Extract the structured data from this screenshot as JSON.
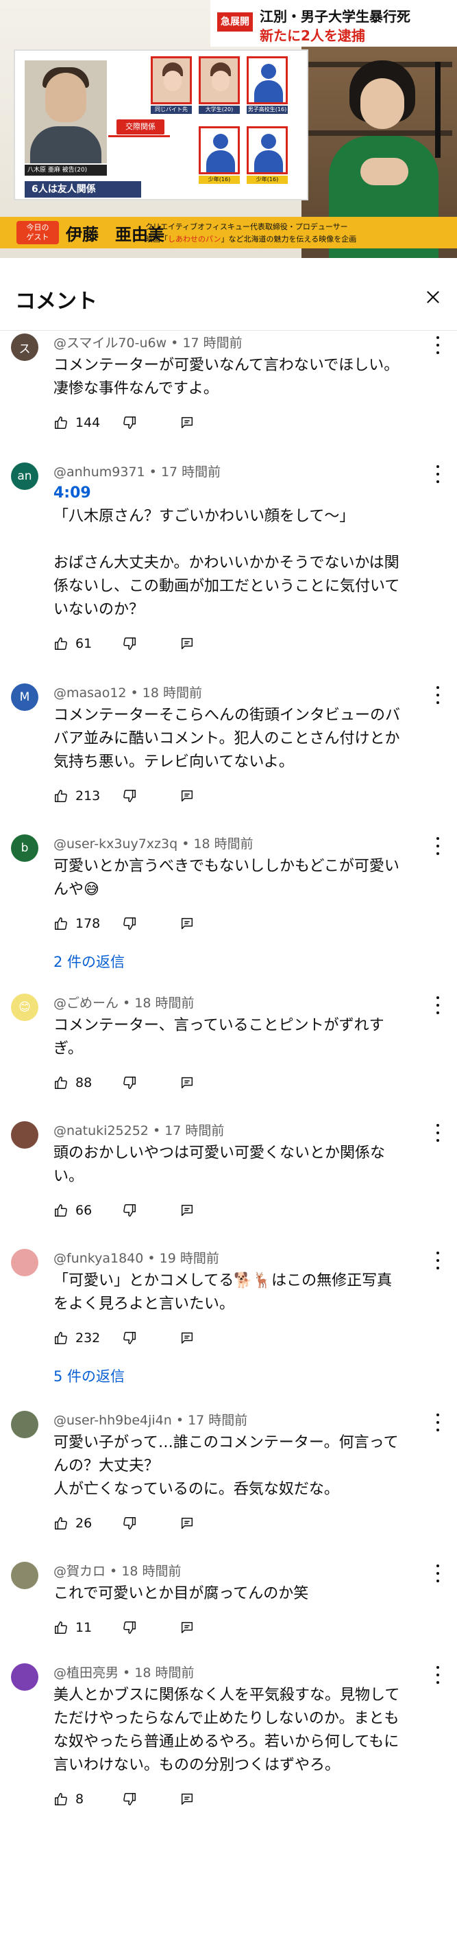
{
  "video": {
    "breaking": "急展開",
    "headline_line1": "江別・男子大学生暴行死",
    "headline_line2": "新たに2人を逮捕",
    "suspect_name_tag": "八木原 亜麻 被告(20)",
    "relation": "交際関係",
    "friends": "6人は友人関係",
    "today_badge": "今日の\nゲスト",
    "guest_name": "伊藤　亜由美",
    "guest_desc_line1": "クリエイティブオフィスキュー代表取締役・プロデューサー",
    "guest_desc_line2_pre": "映画「",
    "guest_desc_line2_hl": "しあわせのパン",
    "guest_desc_line2_post": "」など北海道の魅力を伝える映像を企画",
    "persons": [
      {
        "label": "同じバイト先",
        "kind": "photo"
      },
      {
        "label": "大学生(20)",
        "kind": "photo"
      },
      {
        "label": "男子高校生(16)",
        "kind": "blue"
      },
      {
        "label": "少年(16)",
        "kind": "blue"
      },
      {
        "label": "少年(16)",
        "kind": "blue"
      }
    ]
  },
  "sheet": {
    "title": "コメント"
  },
  "comments": [
    {
      "author": "@スマイル70-u6w",
      "time": "17 時間前",
      "avatar_letter": "ス",
      "avatar_color": "#5c4a3f",
      "timestamp": "",
      "lines": [
        "コメンテーターが可愛いなんて言わないでほしい。",
        "凄惨な事件なんですよ。"
      ],
      "likes": "144",
      "replies": ""
    },
    {
      "author": "@anhum9371",
      "time": "17 時間前",
      "avatar_letter": "an",
      "avatar_color": "#0f6b57",
      "timestamp": "4:09",
      "lines": [
        "「八木原さん？すごいかわいい顔をして〜」",
        "",
        "おばさん大丈夫か。かわいいかかそうでないかは関",
        "係ないし、この動画が加工だということに気付いて",
        "いないのか？"
      ],
      "likes": "61",
      "replies": ""
    },
    {
      "author": "@masao12",
      "time": "18 時間前",
      "avatar_letter": "M",
      "avatar_color": "#2d5fb0",
      "timestamp": "",
      "lines": [
        "コメンテーターそこらへんの街頭インタビューのバ",
        "バア並みに酷いコメント。犯人のことさん付けとか",
        "気持ち悪い。テレビ向いてないよ。"
      ],
      "likes": "213",
      "replies": ""
    },
    {
      "author": "@user-kx3uy7xz3q",
      "time": "18 時間前",
      "avatar_letter": "b",
      "avatar_color": "#1f6e3a",
      "timestamp": "",
      "lines": [
        "可愛いとか言うべきでもないししかもどこが可愛い",
        "んや😅"
      ],
      "likes": "178",
      "replies": "2 件の返信"
    },
    {
      "author": "@ごめーん",
      "time": "18 時間前",
      "avatar_letter": "😊",
      "avatar_color": "#f3e27a",
      "timestamp": "",
      "lines": [
        "コメンテーター、言っていることピントがずれす",
        "ぎ。"
      ],
      "likes": "88",
      "replies": ""
    },
    {
      "author": "@natuki25252",
      "time": "17 時間前",
      "avatar_letter": "",
      "avatar_color": "#7a4a3a",
      "timestamp": "",
      "lines": [
        "頭のおかしいやつは可愛い可愛くないとか関係な",
        "い。"
      ],
      "likes": "66",
      "replies": ""
    },
    {
      "author": "@funkya1840",
      "time": "19 時間前",
      "avatar_letter": "",
      "avatar_color": "#e9a3a3",
      "timestamp": "",
      "lines": [
        "「可愛い」とかコメしてる🐕🦌はこの無修正写真",
        "をよく見ろよと言いたい。"
      ],
      "likes": "232",
      "replies": "5 件の返信"
    },
    {
      "author": "@user-hh9be4ji4n",
      "time": "17 時間前",
      "avatar_letter": "",
      "avatar_color": "#6b7a5a",
      "timestamp": "",
      "lines": [
        "可愛い子がって…誰このコメンテーター。何言って",
        "んの？大丈夫？",
        "人が亡くなっているのに。呑気な奴だな。"
      ],
      "likes": "26",
      "replies": ""
    },
    {
      "author": "@賀カロ",
      "time": "18 時間前",
      "avatar_letter": "",
      "avatar_color": "#8a8a6a",
      "timestamp": "",
      "lines": [
        "これで可愛いとか目が腐ってんのか笑"
      ],
      "likes": "11",
      "replies": ""
    },
    {
      "author": "@植田亮男",
      "time": "18 時間前",
      "avatar_letter": "",
      "avatar_color": "#7a3fb0",
      "timestamp": "",
      "lines": [
        "美人とかブスに関係なく人を平気殺すな。見物して",
        "ただけやったらなんで止めたりしないのか。まとも",
        "な奴やったら普通止めるやろ。若いから何してもに",
        "言いわけない。ものの分別つくはずやろ。"
      ],
      "likes": "8",
      "replies": ""
    }
  ]
}
